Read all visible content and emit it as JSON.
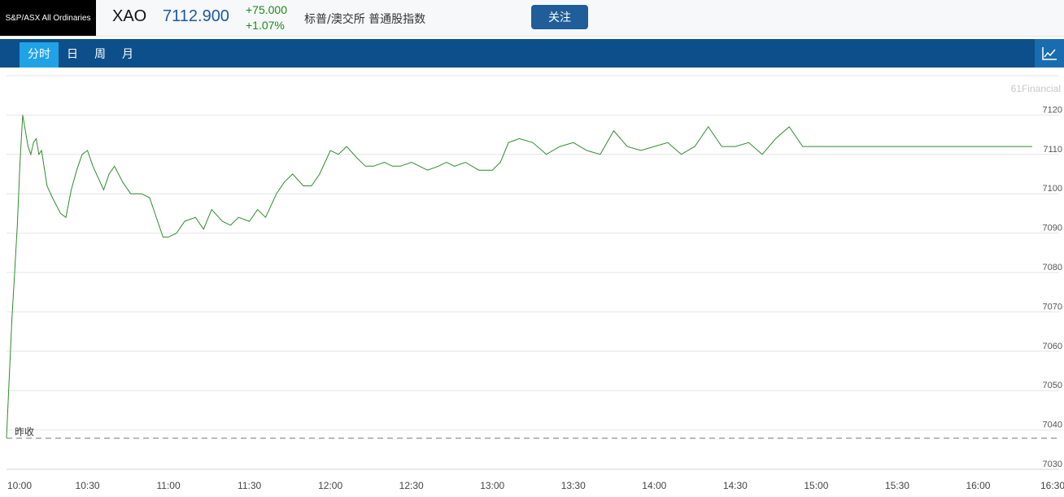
{
  "header": {
    "index_name": "S&P/ASX All Ordinaries",
    "code": "XAO",
    "price": "7112.900",
    "change": "+75.000",
    "change_pct": "+1.07%",
    "name_cn": "标普/澳交所 普通股指数",
    "follow_label": "关注"
  },
  "tabs": [
    {
      "label": "分时",
      "active": true
    },
    {
      "label": "日",
      "active": false
    },
    {
      "label": "周",
      "active": false
    },
    {
      "label": "月",
      "active": false
    }
  ],
  "colors": {
    "line": "#2e8b2e",
    "tab_bar": "#0d4f8a",
    "active_tab": "#1fa3e6",
    "price": "#1a5a9c",
    "change": "#1a8a1a"
  },
  "chart_data": {
    "type": "line",
    "watermark": "61Financial",
    "prev_close_label": "昨收",
    "prev_close": 7037.9,
    "ylim": [
      7030,
      7130
    ],
    "yticks": [
      7030,
      7040,
      7050,
      7060,
      7070,
      7080,
      7090,
      7100,
      7110,
      7120
    ],
    "xticks": [
      "10:00",
      "10:30",
      "11:00",
      "11:30",
      "12:00",
      "12:30",
      "13:00",
      "13:30",
      "14:00",
      "14:30",
      "15:00",
      "15:30",
      "16:00",
      "16:30"
    ],
    "x_start": "10:00",
    "x_end": "16:30",
    "series": [
      {
        "x": [
          "10:00",
          "10:01",
          "10:02",
          "10:03",
          "10:04",
          "10:05",
          "10:06",
          "10:07",
          "10:08",
          "10:09",
          "10:10",
          "10:11",
          "10:12",
          "10:13",
          "10:15",
          "10:17",
          "10:20",
          "10:22",
          "10:24",
          "10:26",
          "10:28",
          "10:30",
          "10:32",
          "10:34",
          "10:36",
          "10:38",
          "10:40",
          "10:43",
          "10:46",
          "10:50",
          "10:53",
          "10:56",
          "10:58",
          "11:00",
          "11:03",
          "11:06",
          "11:10",
          "11:13",
          "11:16",
          "11:20",
          "11:23",
          "11:26",
          "11:30",
          "11:33",
          "11:36",
          "11:40",
          "11:43",
          "11:46",
          "11:50",
          "11:53",
          "11:56",
          "12:00",
          "12:03",
          "12:06",
          "12:10",
          "12:13",
          "12:16",
          "12:20",
          "12:23",
          "12:26",
          "12:30",
          "12:33",
          "12:36",
          "12:40",
          "12:43",
          "12:46",
          "12:50",
          "12:55",
          "13:00",
          "13:03",
          "13:06",
          "13:10",
          "13:15",
          "13:20",
          "13:25",
          "13:30",
          "13:35",
          "13:40",
          "13:45",
          "13:50",
          "13:55",
          "14:00",
          "14:05",
          "14:10",
          "14:15",
          "14:20",
          "14:25",
          "14:30",
          "14:35",
          "14:40",
          "14:45",
          "14:50",
          "14:55",
          "15:00",
          "15:05",
          "15:10",
          "15:15",
          "15:20",
          "15:25",
          "15:30",
          "15:35",
          "15:40",
          "15:45",
          "15:50",
          "15:55",
          "15:57",
          "16:00",
          "16:05",
          "16:10",
          "16:20"
        ],
        "y": [
          7038,
          7053,
          7068,
          7080,
          7092,
          7108,
          7120,
          7116,
          7112,
          7110,
          7113,
          7114,
          7110,
          7111,
          7102,
          7099,
          7095,
          7094,
          7101,
          7106,
          7110,
          7111,
          7107,
          7104,
          7101,
          7105,
          7107,
          7103,
          7100,
          7100,
          7099,
          7093,
          7089,
          7089,
          7090,
          7093,
          7094,
          7091,
          7096,
          7093,
          7092,
          7094,
          7093,
          7096,
          7094,
          7100,
          7103,
          7105,
          7102,
          7102,
          7105,
          7111,
          7110,
          7112,
          7109,
          7107,
          7107,
          7108,
          7107,
          7107,
          7108,
          7107,
          7106,
          7107,
          7108,
          7107,
          7108,
          7106,
          7106,
          7108,
          7113,
          7114,
          7113,
          7110,
          7112,
          7113,
          7111,
          7110,
          7116,
          7112,
          7111,
          7112,
          7113,
          7110,
          7112,
          7117,
          7112,
          7112,
          7113,
          7110,
          7114,
          7117,
          7112,
          7112,
          7112,
          7112,
          7112,
          7112,
          7112,
          7112,
          7112,
          7112,
          7112,
          7112,
          7112,
          7112,
          7112,
          7112,
          7112,
          7112
        ]
      }
    ]
  }
}
